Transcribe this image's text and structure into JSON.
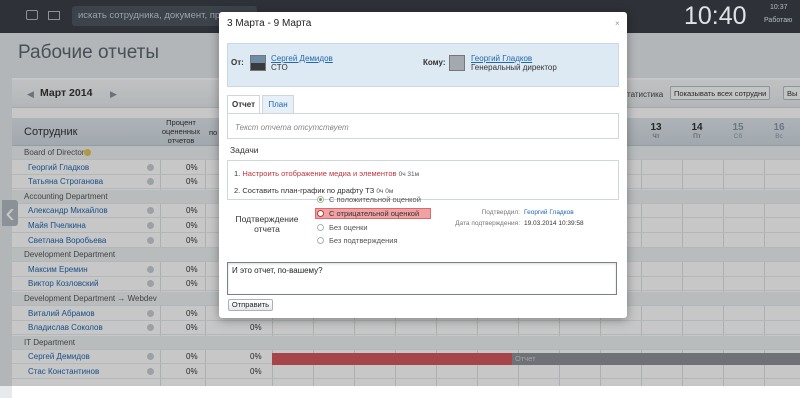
{
  "topbar": {
    "search_placeholder": "искать сотрудника, документ, прочее",
    "clock": "10:40",
    "clock_small": "10:37",
    "status": "Работаю"
  },
  "page": {
    "title": "Рабочие отчеты",
    "month": "Март 2014",
    "stats_label": "статистика",
    "filter_select": "Показывать всех сотрудни",
    "extra_select": "Вы"
  },
  "table": {
    "col_employee": "Сотрудник",
    "col_percent": "Процент оцененных отчетов",
    "col_po": "по",
    "days": [
      {
        "n": "13",
        "w": "Чт"
      },
      {
        "n": "14",
        "w": "Пт"
      },
      {
        "n": "15",
        "w": "Сб"
      },
      {
        "n": "16",
        "w": "Вс"
      }
    ],
    "rows": [
      {
        "type": "group",
        "label": "Board of Directors"
      },
      {
        "type": "emp",
        "name": "Георгий Гладков",
        "pct": "0%",
        "val": ""
      },
      {
        "type": "emp",
        "name": "Татьяна Строганова",
        "pct": "0%",
        "val": ""
      },
      {
        "type": "group",
        "label": "Accounting Department"
      },
      {
        "type": "emp",
        "name": "Александр Михайлов",
        "pct": "0%",
        "val": ""
      },
      {
        "type": "emp",
        "name": "Майя Пчелкина",
        "pct": "0%",
        "val": ""
      },
      {
        "type": "emp",
        "name": "Светлана Воробьева",
        "pct": "0%",
        "val": ""
      },
      {
        "type": "group",
        "label": "Development Department"
      },
      {
        "type": "emp",
        "name": "Максим Еремин",
        "pct": "0%",
        "val": ""
      },
      {
        "type": "emp",
        "name": "Виктор Козловский",
        "pct": "0%",
        "val": ""
      },
      {
        "type": "group",
        "label": "Development Department → Webdev"
      },
      {
        "type": "emp",
        "name": "Виталий Абрамов",
        "pct": "0%",
        "val": "0%"
      },
      {
        "type": "emp",
        "name": "Владислав Соколов",
        "pct": "0%",
        "val": "0%"
      },
      {
        "type": "group",
        "label": "IT Department"
      },
      {
        "type": "emp",
        "name": "Сергей Демидов",
        "pct": "0%",
        "val": "0%"
      },
      {
        "type": "emp",
        "name": "Стас Константинов",
        "pct": "0%",
        "val": "0%"
      }
    ],
    "bar_label": "Отчет"
  },
  "modal": {
    "title": "3 Марта - 9 Марта",
    "close": "×",
    "from_label": "От:",
    "from_name": "Сергей Демидов",
    "from_role": "CTO",
    "to_label": "Кому:",
    "to_name": "Георгий Гладков",
    "to_role": "Генеральный директор",
    "tab_report": "Отчет",
    "tab_plan": "План",
    "report_text": "Текст отчета отсутствует",
    "tasks_header": "Задачи",
    "tasks": [
      {
        "num": "1.",
        "text": "Настроить отображение медиа и элементов",
        "time": "0ч 31м"
      },
      {
        "num": "2.",
        "text": "Составить план-график по драфту ТЗ",
        "time": "0ч 0м"
      }
    ],
    "confirm_label": "Подтверждение отчета",
    "options": [
      "С положительной оценкой",
      "С отрицательной оценкой",
      "Без оценки",
      "Без подтверждения"
    ],
    "confirmed_by_label": "Подтвердил:",
    "confirmed_by": "Георгий Гладков",
    "confirm_date_label": "Дата подтверждения:",
    "confirm_date": "19.03.2014 10:39:58",
    "comment": "И это отчет, по-вашему?",
    "send": "Отправить"
  },
  "colors": {
    "accent": "#2067b0",
    "negative": "#f2a1a3",
    "topbar": "#2e3238"
  }
}
